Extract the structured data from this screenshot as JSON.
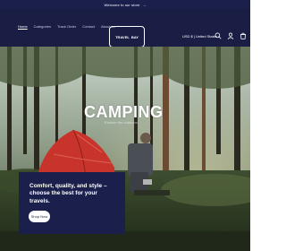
{
  "announcement": {
    "text": "Welcome to our store",
    "icon": "arrow-right-icon"
  },
  "header": {
    "nav": [
      {
        "label": "Home",
        "active": true
      },
      {
        "label": "Categories",
        "active": false
      },
      {
        "label": "Track Order",
        "active": false
      },
      {
        "label": "Contact",
        "active": false
      },
      {
        "label": "About us",
        "active": false
      }
    ],
    "logo": {
      "part1": "TRAVEL",
      "part2": "BAY"
    },
    "locale": "USD $ | United States",
    "icons": [
      "search-icon",
      "user-icon",
      "cart-icon"
    ]
  },
  "hero": {
    "title": "CAMPING",
    "subtitle": "Explore the outdoors",
    "card": {
      "text": "Comfort, quality, and style – choose the best for your travels.",
      "button_label": "Shop Now"
    }
  },
  "colors": {
    "navy": "#1b1f4b",
    "tent": "#c8342b",
    "forest": "#2f3a2b"
  }
}
